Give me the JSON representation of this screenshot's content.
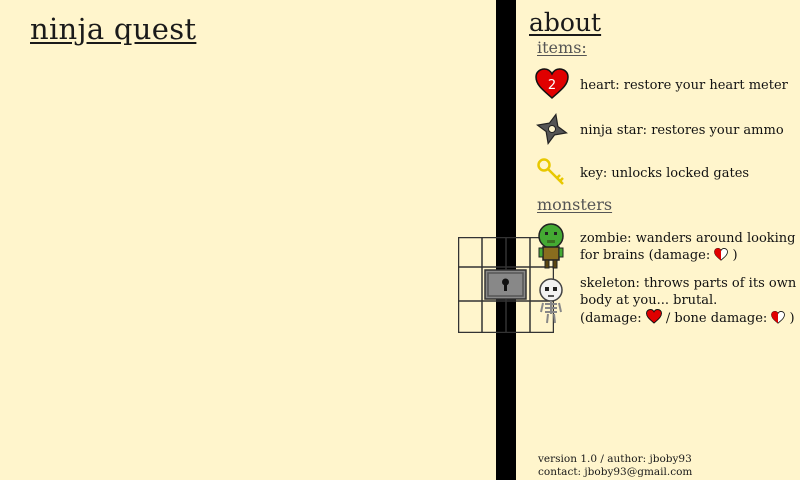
{
  "game_title": "ninja quest",
  "about": {
    "heading": "about",
    "items_heading": "items:",
    "items": [
      {
        "icon": "heart-icon",
        "badge": "2",
        "description": "heart: restore your heart meter"
      },
      {
        "icon": "ninja-star-icon",
        "description": "ninja star: restores your ammo"
      },
      {
        "icon": "key-icon",
        "description": "key: unlocks locked gates"
      }
    ],
    "monsters_heading": "monsters",
    "zombie": {
      "line1": "zombie: wanders around looking",
      "line2_prefix": "for brains (damage: ",
      "line2_suffix": " )"
    },
    "skeleton": {
      "line1": "skeleton: throws parts of its own",
      "line2": "body at you... brutal.",
      "line3_prefix": "(damage: ",
      "line3_mid": " / bone damage: ",
      "line3_suffix": " )"
    }
  },
  "footer": {
    "line1": "version 1.0 / author: jboby93",
    "line2": "contact: jboby93@gmail.com"
  },
  "colors": {
    "background": "#fff5cc",
    "heart": "#e00000",
    "key": "#f5e040",
    "zombie": "#44aa33",
    "gate": "#888888"
  }
}
